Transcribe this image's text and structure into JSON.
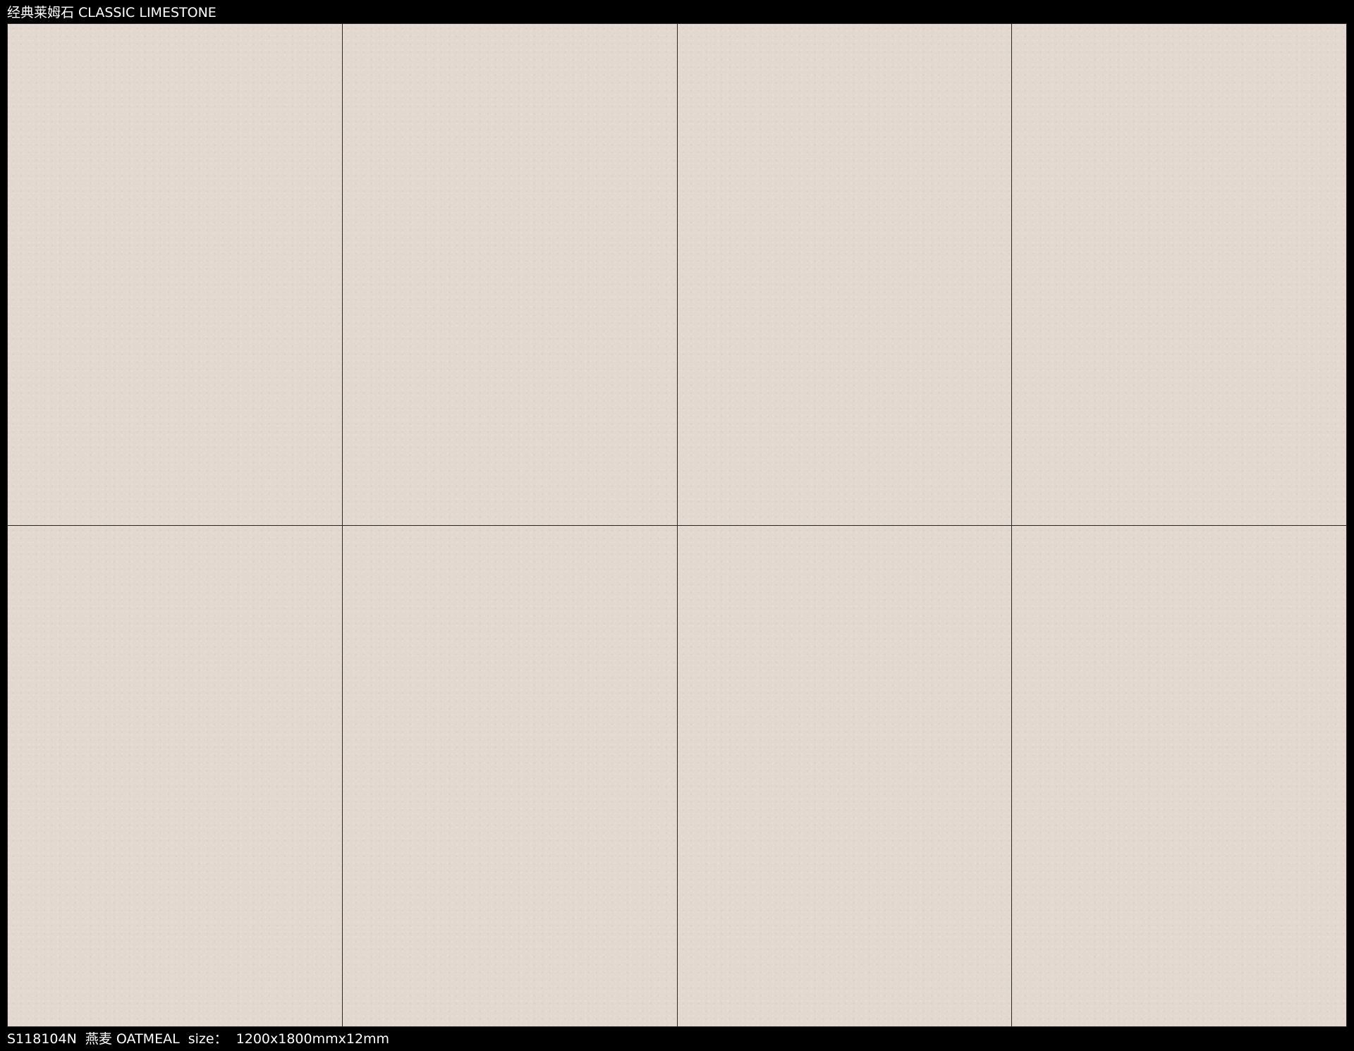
{
  "header": {
    "title": "经典莱姆石 CLASSIC LIMESTONE"
  },
  "tiles": {
    "rows": 2,
    "columns": 4,
    "color": "#e2d8cf",
    "grout_color": "#2a2726"
  },
  "footer": {
    "caption": "S118104N  燕麦 OATMEAL  size：  1200x1800mmx12mm"
  }
}
